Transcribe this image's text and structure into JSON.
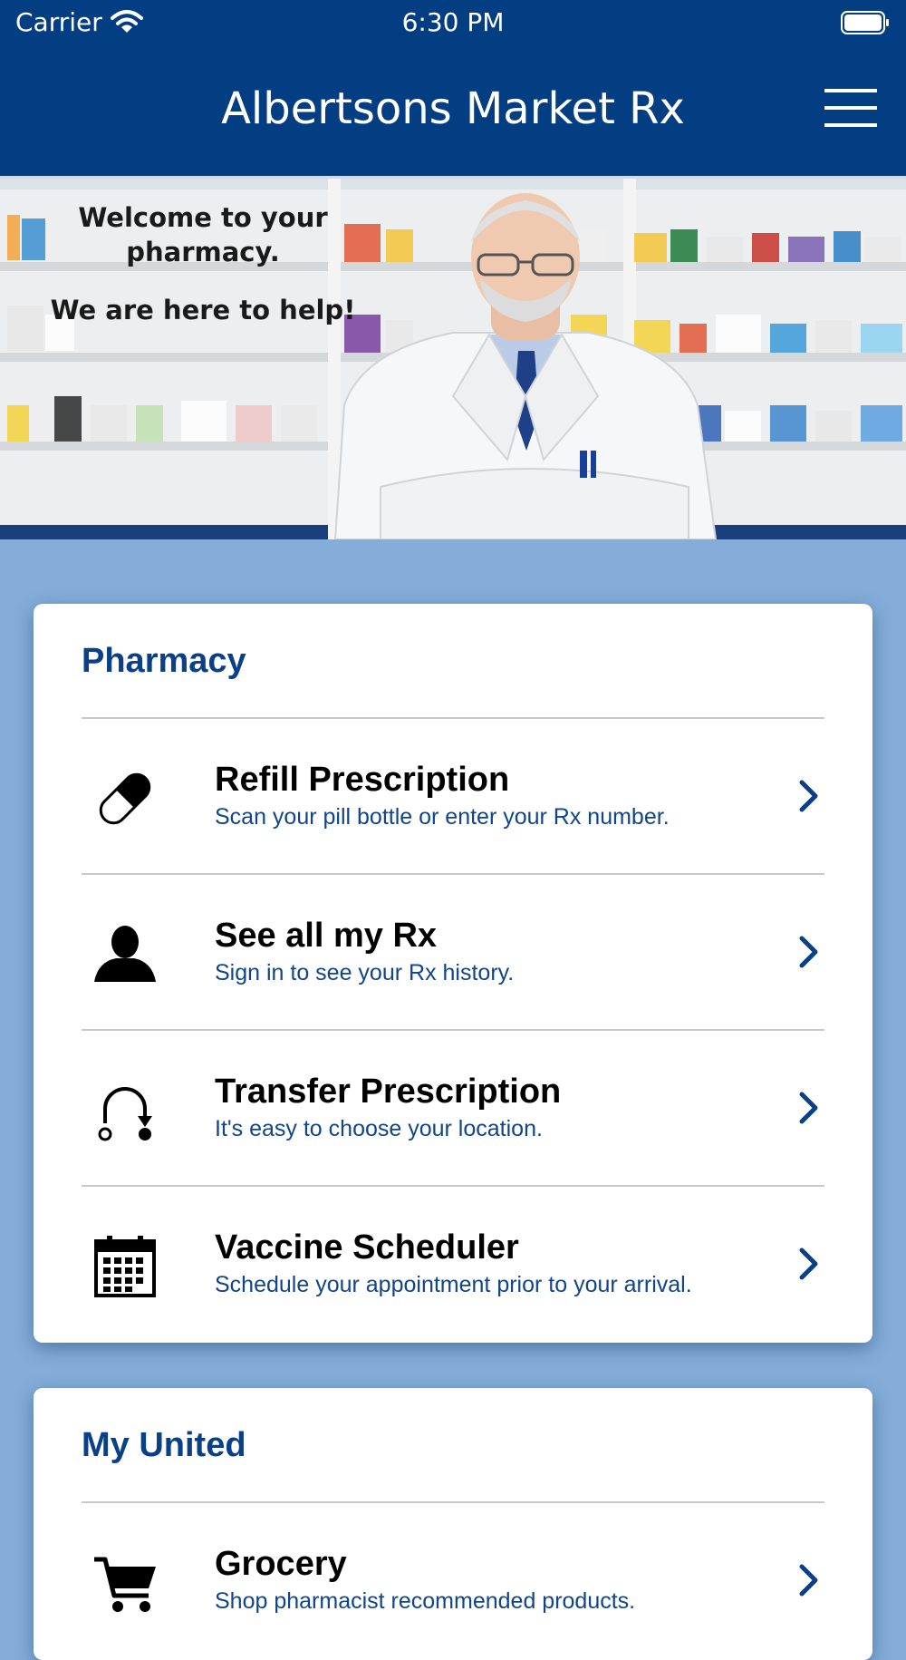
{
  "status_bar": {
    "carrier": "Carrier",
    "time": "6:30 PM"
  },
  "header": {
    "title": "Albertsons Market Rx"
  },
  "hero": {
    "line1": "Welcome to your pharmacy.",
    "line2": "We are here to help!"
  },
  "sections": [
    {
      "title": "Pharmacy",
      "items": [
        {
          "title": "Refill Prescription",
          "subtitle": "Scan your pill bottle or enter your Rx number.",
          "icon": "pill-icon"
        },
        {
          "title": "See all my Rx",
          "subtitle": "Sign in to see your Rx history.",
          "icon": "person-icon"
        },
        {
          "title": "Transfer Prescription",
          "subtitle": "It's easy to choose your location.",
          "icon": "transfer-icon"
        },
        {
          "title": "Vaccine Scheduler",
          "subtitle": "Schedule your appointment prior to your arrival.",
          "icon": "calendar-icon"
        }
      ]
    },
    {
      "title": "My United",
      "items": [
        {
          "title": "Grocery",
          "subtitle": "Shop pharmacist recommended products.",
          "icon": "cart-icon"
        }
      ]
    }
  ],
  "colors": {
    "header": "#043e82",
    "background": "#84aed9",
    "accent": "#0b4089",
    "chevron": "#0b4089"
  }
}
